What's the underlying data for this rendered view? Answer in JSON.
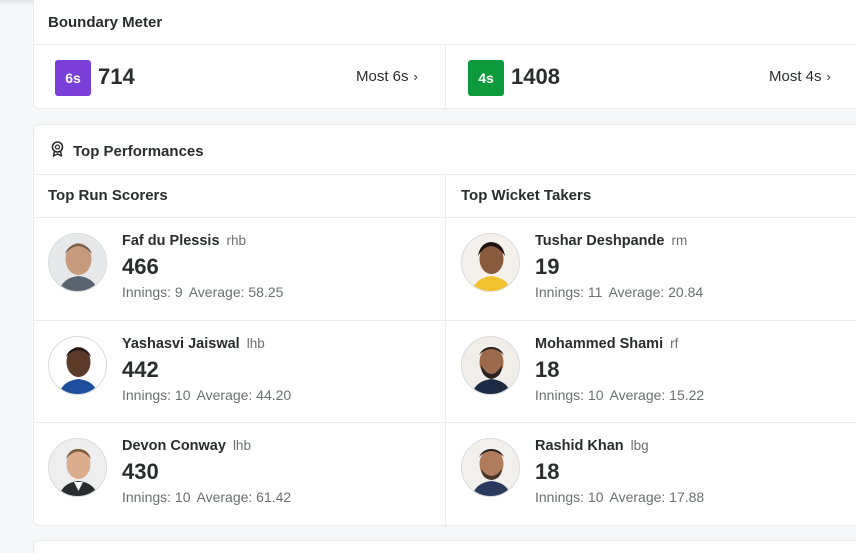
{
  "boundary": {
    "title": "Boundary Meter",
    "sixes": {
      "badge": "6s",
      "count": "714",
      "link": "Most 6s",
      "color": "#7a3fd8"
    },
    "fours": {
      "badge": "4s",
      "count": "1408",
      "link": "Most 4s",
      "color": "#0c9a3c"
    }
  },
  "performances": {
    "title": "Top Performances",
    "icon": "award-icon",
    "run_scorers": {
      "heading": "Top Run Scorers",
      "players": [
        {
          "name": "Faf du Plessis",
          "style": "rhb",
          "stat": "466",
          "innings": "Innings: 9",
          "average": "Average: 58.25"
        },
        {
          "name": "Yashasvi Jaiswal",
          "style": "lhb",
          "stat": "442",
          "innings": "Innings: 10",
          "average": "Average: 44.20"
        },
        {
          "name": "Devon Conway",
          "style": "lhb",
          "stat": "430",
          "innings": "Innings: 10",
          "average": "Average: 61.42"
        }
      ]
    },
    "wicket_takers": {
      "heading": "Top Wicket Takers",
      "players": [
        {
          "name": "Tushar Deshpande",
          "style": "rm",
          "stat": "19",
          "innings": "Innings: 11",
          "average": "Average: 20.84"
        },
        {
          "name": "Mohammed Shami",
          "style": "rf",
          "stat": "18",
          "innings": "Innings: 10",
          "average": "Average: 15.22"
        },
        {
          "name": "Rashid Khan",
          "style": "lbg",
          "stat": "18",
          "innings": "Innings: 10",
          "average": "Average: 17.88"
        }
      ]
    }
  }
}
